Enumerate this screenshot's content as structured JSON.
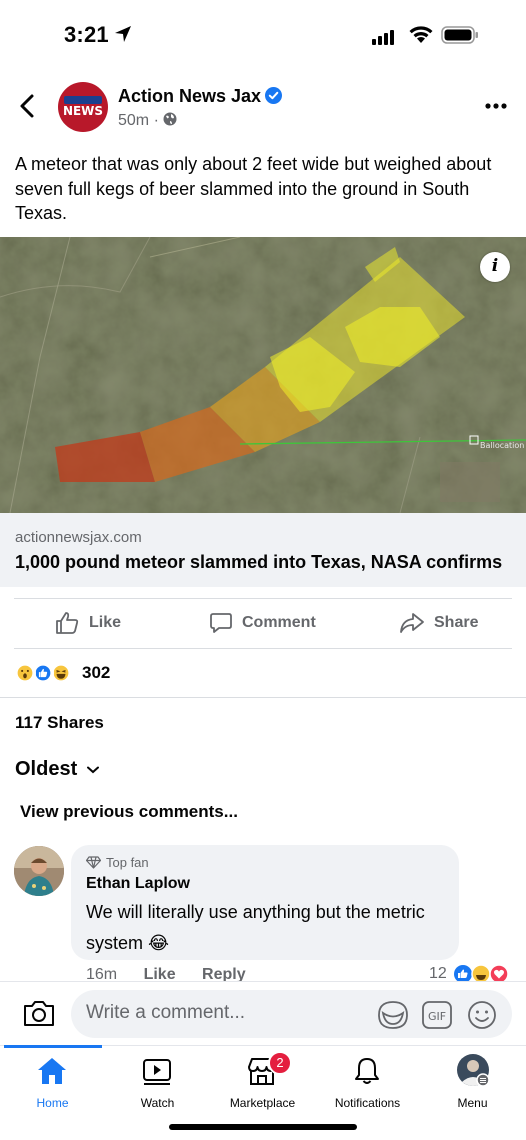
{
  "status_bar": {
    "time": "3:21"
  },
  "post": {
    "page_name": "Action News Jax",
    "age": "50m",
    "separator": "·",
    "logo_text": "NEWS",
    "text": "A meteor that was only about 2 feet wide but weighed about seven full kegs of beer slammed into the ground in South Texas.",
    "map_label": "Ballocation"
  },
  "link": {
    "domain": "actionnewsjax.com",
    "title": "1,000 pound meteor slammed into Texas, NASA confirms"
  },
  "actions": {
    "like": "Like",
    "comment": "Comment",
    "share": "Share"
  },
  "reactions": {
    "count": "302"
  },
  "shares": "117 Shares",
  "sort_label": "Oldest",
  "view_previous": "View previous comments...",
  "comment": {
    "badge": "Top fan",
    "author": "Ethan Laplow",
    "text": "We will literally use anything but the metric system 😂",
    "time": "16m",
    "like": "Like",
    "reply": "Reply",
    "reaction_count": "12"
  },
  "composer": {
    "placeholder": "Write a comment...",
    "gif_label": "GIF"
  },
  "tabs": [
    {
      "label": "Home"
    },
    {
      "label": "Watch"
    },
    {
      "label": "Marketplace",
      "badge": "2"
    },
    {
      "label": "Notifications"
    },
    {
      "label": "Menu"
    }
  ],
  "colors": {
    "accent": "#1877f2",
    "badge": "#e41e3f",
    "secondary_text": "#65676b"
  }
}
